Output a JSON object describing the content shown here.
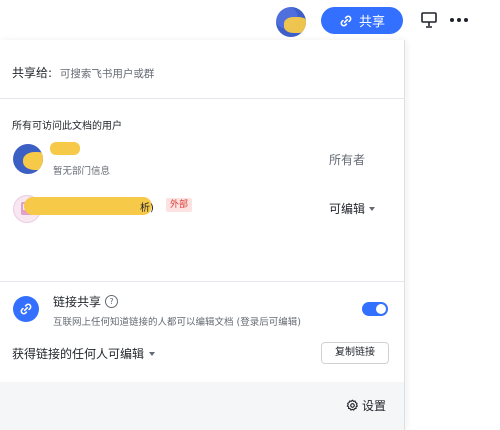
{
  "toolbar": {
    "share_label": "共享",
    "icons": {
      "share": "link-icon",
      "present": "present-icon",
      "more": "more-icon"
    }
  },
  "share_panel": {
    "share_to_label": "共享给:",
    "share_to_placeholder": "可搜索飞书用户或群",
    "access_title": "所有可访问此文档的用户",
    "users": [
      {
        "subtitle": "暂无部门信息",
        "role": "所有者"
      },
      {
        "name_suffix": "析)",
        "tag": "外部",
        "role": "可编辑"
      }
    ],
    "link_share": {
      "title": "链接共享",
      "description": "互联网上任何知道链接的人都可以编辑文档 (登录后可编辑)",
      "enabled": true
    },
    "permission_label": "获得链接的任何人可编辑",
    "copy_link_label": "复制链接",
    "settings_label": "设置"
  },
  "colors": {
    "accent": "#3370ff",
    "external_tag": "#d83931"
  }
}
